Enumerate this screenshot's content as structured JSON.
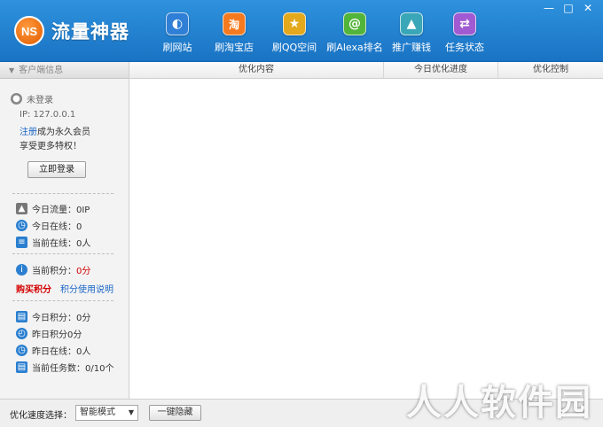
{
  "app": {
    "logo_mark": "NS",
    "title": "流量神器"
  },
  "nav": [
    {
      "label": "刷网站",
      "icon": "globe-icon",
      "glyph": "◐",
      "color": "#2f7fd6"
    },
    {
      "label": "刷淘宝店",
      "icon": "taobao-icon",
      "glyph": "淘",
      "color": "#f57a1f"
    },
    {
      "label": "刷QQ空间",
      "icon": "star-icon",
      "glyph": "★",
      "color": "#e3a81b"
    },
    {
      "label": "刷Alexa排名",
      "icon": "alexa-icon",
      "glyph": "@",
      "color": "#52b43a"
    },
    {
      "label": "推广赚钱",
      "icon": "rocket-icon",
      "glyph": "▲",
      "color": "#3aa7b8"
    },
    {
      "label": "任务状态",
      "icon": "swap-icon",
      "glyph": "⇄",
      "color": "#a05ad2"
    }
  ],
  "window": {
    "minimize": "—",
    "maximize": "□",
    "close": "✕"
  },
  "sidebar": {
    "header": "客户端信息",
    "user_status": "未登录",
    "ip": "IP: 127.0.0.1",
    "register_link": "注册",
    "register_text": "成为永久会员",
    "perks": "享受更多特权！",
    "login_button": "立即登录",
    "today_traffic": "今日流量：0IP",
    "today_online": "今日在线：0",
    "current_online": "当前在线：0人",
    "points_label": "当前积分：",
    "points_value": "0分",
    "buy_points": "购买积分",
    "points_help": "积分使用说明",
    "today_points": "今日积分：0分",
    "yesterday_points": "昨日积分0分",
    "yesterday_online": "昨日在线：0人",
    "task_count": "当前任务数：0/10个"
  },
  "table": {
    "columns": [
      "优化内容",
      "今日优化进度",
      "优化控制"
    ]
  },
  "footer": {
    "speed_label": "优化速度选择：",
    "speed_value": "智能模式",
    "hide_button": "一键隐藏"
  },
  "watermark": "人人软件园",
  "colors": {
    "header": "#2e92dd",
    "link": "#1a66c7",
    "alert": "#d40000"
  }
}
